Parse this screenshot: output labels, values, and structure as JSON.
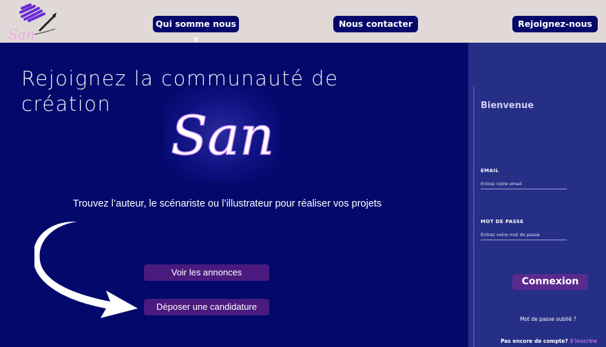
{
  "header": {
    "logo_text": "San",
    "nav": [
      "Qui somme nous ?",
      "Nous contacter",
      "Rejoignez-nous"
    ]
  },
  "hero": {
    "title": "Rejoignez la communauté de création",
    "brand": "San",
    "subtitle": "Trouvez l’auteur, le scénariste ou l’illustrateur pour réaliser vos projets",
    "buttons": [
      "Voir les annonces",
      "Déposer une candidature"
    ]
  },
  "login": {
    "welcome": "Bienvenue",
    "email_label": "EMAIL",
    "email_placeholder": "Entrez votre email",
    "password_label": "MOT DE PASSE",
    "password_placeholder": "Entrez votre mot de passe",
    "submit": "Connexion",
    "forgot": "Mot de passe oublié ?",
    "no_account": "Pas encore de compte?",
    "signup": "S'inscrire"
  },
  "colors": {
    "header_bg": "#e0d9d8",
    "main_bg": "#02096b",
    "panel_bg": "#262f86",
    "nav_button": "#04086a",
    "hero_button": "#4a1a7e",
    "accent_purple": "#b06be6",
    "logo_pink": "#f3a6e6"
  },
  "icons": [
    "brush-logo-icon",
    "curved-arrow-icon"
  ]
}
